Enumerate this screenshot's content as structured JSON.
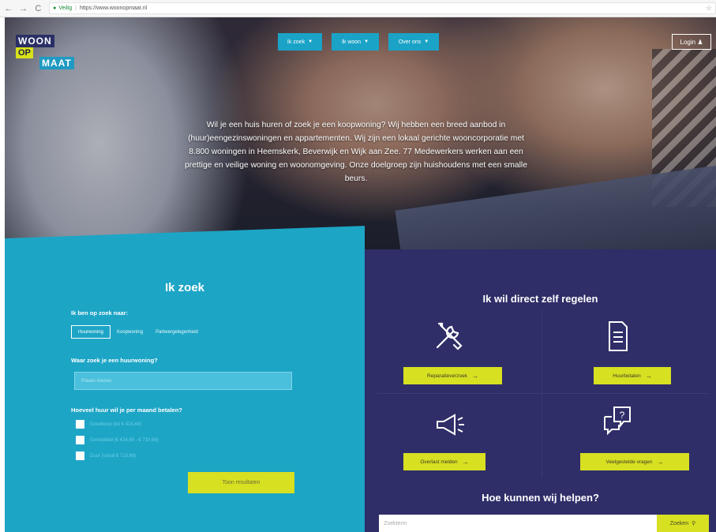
{
  "browser": {
    "back": "←",
    "forward": "→",
    "reload": "C",
    "secure_label": "Veilig",
    "url": "https://www.woonopmaat.nl"
  },
  "header": {
    "logo": {
      "line1": "WOON",
      "line2": "OP",
      "line3": "MAAT"
    },
    "menu": [
      {
        "label": "Ik zoek"
      },
      {
        "label": "Ik woon"
      },
      {
        "label": "Over ons"
      }
    ],
    "login_label": "Login"
  },
  "hero": {
    "text": "Wil je een huis huren of zoek je een koopwoning? Wij hebben een breed aanbod in (huur)eengezinswoningen en appartementen. Wij zijn een lokaal gerichte wooncorporatie met 8.800 woningen in Heemskerk, Beverwijk en Wijk aan Zee. 77 Medewerkers werken aan een prettige en veilige woning en woonomgeving. Onze doelgroep zijn huishoudens met een smalle beurs."
  },
  "search": {
    "title": "Ik zoek",
    "looking_for_label": "Ik ben op zoek naar:",
    "tabs": [
      {
        "label": "Huurwoning"
      },
      {
        "label": "Koopwoning"
      },
      {
        "label": "Parkeergelegenheid"
      }
    ],
    "location_label": "Waar zoek je een huurwoning?",
    "location_placeholder": "Plaats kiezen",
    "rent_label": "Hoeveel huur wil je per maand betalen?",
    "rent_options": [
      {
        "label": "Goedkoop (tot € 424,44)"
      },
      {
        "label": "Gemiddeld (€ 424,45 - € 710,68)"
      },
      {
        "label": "Duur (vanaf € 710,69)"
      }
    ],
    "submit_label": "Toon resultaten"
  },
  "self_service": {
    "title": "Ik wil direct zelf regelen",
    "tiles": [
      {
        "icon": "tools-icon",
        "label": "Reparatieverzoek"
      },
      {
        "icon": "document-icon",
        "label": "Huurbetalen"
      },
      {
        "icon": "megaphone-icon",
        "label": "Overlast melden"
      },
      {
        "icon": "question-chat-icon",
        "label": "Veelgestelde vragen"
      }
    ]
  },
  "help": {
    "title": "Hoe kunnen wij helpen?",
    "placeholder": "Zoekterm",
    "button_label": "Zoeken"
  },
  "colors": {
    "teal": "#1da5c6",
    "navy": "#2f2e68",
    "lime": "#d7e021"
  }
}
